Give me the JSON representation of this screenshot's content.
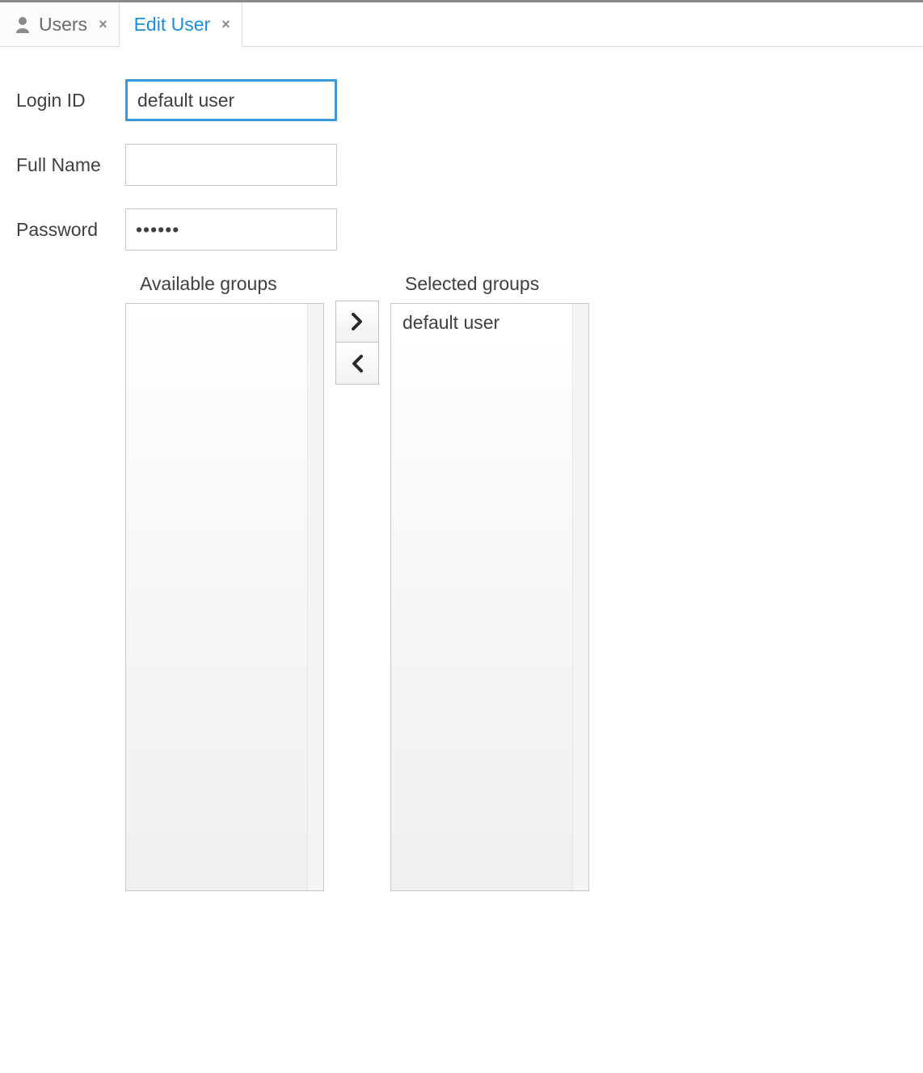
{
  "tabs": {
    "items": [
      {
        "label": "Users",
        "active": false
      },
      {
        "label": "Edit User",
        "active": true
      }
    ]
  },
  "form": {
    "login_id": {
      "label": "Login ID",
      "value": "default user"
    },
    "full_name": {
      "label": "Full Name",
      "value": ""
    },
    "password": {
      "label": "Password",
      "value": "••••••"
    }
  },
  "groups": {
    "available": {
      "label": "Available groups",
      "items": []
    },
    "selected": {
      "label": "Selected groups",
      "items": [
        "default user"
      ]
    }
  }
}
